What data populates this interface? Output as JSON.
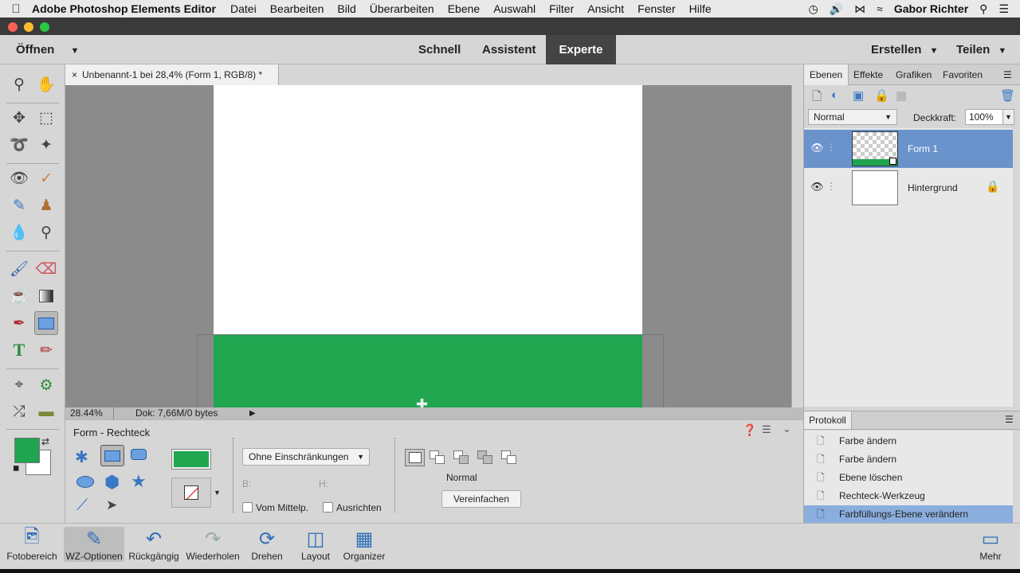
{
  "menubar": {
    "app_name": "Adobe Photoshop Elements Editor",
    "items": [
      "Datei",
      "Bearbeiten",
      "Bild",
      "Überarbeiten",
      "Ebene",
      "Auswahl",
      "Filter",
      "Ansicht",
      "Fenster",
      "Hilfe"
    ],
    "user": "Gabor Richter"
  },
  "topbar": {
    "open_label": "Öffnen",
    "modes": [
      "Schnell",
      "Assistent",
      "Experte"
    ],
    "active_mode": "Experte",
    "create_label": "Erstellen",
    "share_label": "Teilen"
  },
  "document": {
    "tab_title": "Unbenannt-1 bei 28,4% (Form 1, RGB/8) *",
    "zoom": "28.44%",
    "doc_info": "Dok: 7,66M/0 bytes",
    "shape_color": "#21a650"
  },
  "options": {
    "tool_title": "Form - Rechteck",
    "constraint": "Ohne Einschränkungen",
    "width_label": "B:",
    "height_label": "H:",
    "from_center_label": "Vom Mittelp.",
    "align_label": "Ausrichten",
    "mode_label": "Normal",
    "simplify_label": "Vereinfachen",
    "fill_color": "#21a650"
  },
  "layers_panel": {
    "tabs": [
      "Ebenen",
      "Effekte",
      "Grafiken",
      "Favoriten"
    ],
    "blend_mode": "Normal",
    "opacity_label": "Deckkraft:",
    "opacity_value": "100%",
    "layers": [
      {
        "name": "Form 1",
        "selected": true
      },
      {
        "name": "Hintergrund",
        "selected": false
      }
    ]
  },
  "history_panel": {
    "title": "Protokoll",
    "items": [
      "Farbe ändern",
      "Farbe ändern",
      "Ebene löschen",
      "Rechteck-Werkzeug",
      "Farbfüllungs-Ebene verändern"
    ],
    "selected_index": 4
  },
  "colors": {
    "foreground": "#1fa44f",
    "background": "#ffffff"
  },
  "bottombar": {
    "items": [
      "Fotobereich",
      "WZ-Optionen",
      "Rückgängig",
      "Wiederholen",
      "Drehen",
      "Layout",
      "Organizer"
    ],
    "more_label": "Mehr"
  }
}
